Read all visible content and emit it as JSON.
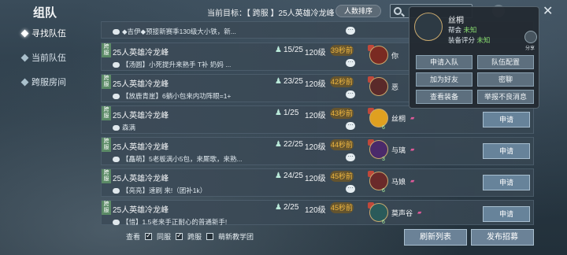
{
  "title": "组队",
  "sidebar": {
    "items": [
      {
        "label": "寻找队伍",
        "active": true
      },
      {
        "label": "当前队伍",
        "active": false
      },
      {
        "label": "跨服房间",
        "active": false
      }
    ]
  },
  "header": {
    "target_label": "当前目标：【 跨服 】25人英雄冷龙峰",
    "sort_button": "人数排序",
    "search_placeholder": ""
  },
  "rows": [
    {
      "tag": "",
      "name": "",
      "count": "",
      "level": "",
      "time": "",
      "msg": "◆吉伊◆预接新赛季130级大小铁，新...",
      "leader": "",
      "lvl": ""
    },
    {
      "tag": "跨服",
      "name": "25人英雄冷龙峰",
      "count": "15/25",
      "level": "120级",
      "time": "39秒前",
      "msg": "【汤圆】小死提升来熟手 T补 奶妈 ...",
      "leader": "你",
      "lvl": ""
    },
    {
      "tag": "跨服",
      "name": "25人英雄冷龙峰",
      "count": "23/25",
      "level": "120级",
      "time": "42秒前",
      "msg": "【放鹿青崖】6躺小包来内功阵眼=1+",
      "leader": "恶",
      "lvl": ""
    },
    {
      "tag": "跨服",
      "name": "25人英雄冷龙峰",
      "count": "1/25",
      "level": "120级",
      "time": "43秒前",
      "msg": "森满",
      "leader": "丝桐",
      "lvl": "6"
    },
    {
      "tag": "跨服",
      "name": "25人英雄冷龙峰",
      "count": "22/25",
      "level": "120级",
      "time": "44秒前",
      "msg": "【矗萌】5老板满小5包，来厮歌，来熟...",
      "leader": "与璃",
      "lvl": "3"
    },
    {
      "tag": "跨服",
      "name": "25人英雄冷龙峰",
      "count": "24/25",
      "level": "120级",
      "time": "45秒前",
      "msg": "【亮亮】速刷 来!（团补1k）",
      "leader": "马娘",
      "lvl": "6"
    },
    {
      "tag": "跨服",
      "name": "25人英雄冷龙峰",
      "count": "2/25",
      "level": "120级",
      "time": "45秒前",
      "msg": "【惜】1.5老来手正耐心的普通新手!",
      "leader": "莫声谷",
      "lvl": "6"
    }
  ],
  "apply_label": "申请",
  "popup": {
    "name": "丝桐",
    "guild_label": "帮会",
    "guild_value": "未知",
    "score_label": "装备评分",
    "score_value": "未知",
    "share_label": "分享",
    "buttons": [
      "申请入队",
      "队伍配置",
      "加为好友",
      "密聊",
      "查看装备",
      "举报不良消息"
    ]
  },
  "bottom": {
    "view_label": "查看",
    "filters": [
      {
        "label": "同服",
        "checked": true
      },
      {
        "label": "跨服",
        "checked": true
      },
      {
        "label": "萌新教学团",
        "checked": false
      }
    ],
    "refresh_button": "刷新列表",
    "publish_button": "发布招募"
  },
  "colors": {
    "accent_time": "#f0b840",
    "apply_bg": "#67839a",
    "guild_value": "#8be070"
  }
}
